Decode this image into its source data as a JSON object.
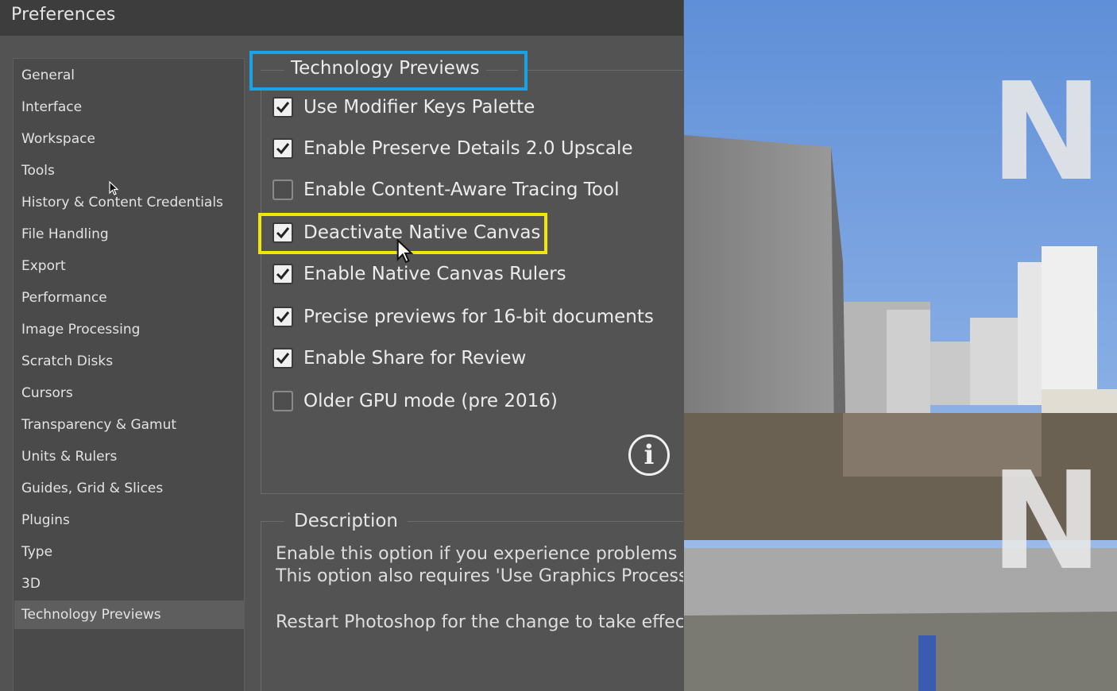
{
  "window": {
    "title": "Preferences"
  },
  "sidebar": {
    "items": [
      {
        "label": "General"
      },
      {
        "label": "Interface"
      },
      {
        "label": "Workspace"
      },
      {
        "label": "Tools"
      },
      {
        "label": "History & Content Credentials"
      },
      {
        "label": "File Handling"
      },
      {
        "label": "Export"
      },
      {
        "label": "Performance"
      },
      {
        "label": "Image Processing"
      },
      {
        "label": "Scratch Disks"
      },
      {
        "label": "Cursors"
      },
      {
        "label": "Transparency & Gamut"
      },
      {
        "label": "Units & Rulers"
      },
      {
        "label": "Guides, Grid & Slices"
      },
      {
        "label": "Plugins"
      },
      {
        "label": "Type"
      },
      {
        "label": "3D"
      },
      {
        "label": "Technology Previews",
        "selected": true
      }
    ]
  },
  "technology_previews": {
    "title": "Technology Previews",
    "options": [
      {
        "label": "Use Modifier Keys Palette",
        "checked": true
      },
      {
        "label": "Enable Preserve Details 2.0 Upscale",
        "checked": true
      },
      {
        "label": "Enable Content-Aware Tracing Tool",
        "checked": false
      },
      {
        "label": "Deactivate Native Canvas",
        "checked": true
      },
      {
        "label": "Enable Native Canvas Rulers",
        "checked": true
      },
      {
        "label": "Precise previews for 16-bit documents",
        "checked": true
      },
      {
        "label": "Enable Share for Review",
        "checked": true
      },
      {
        "label": "Older GPU mode (pre 2016)",
        "checked": false
      }
    ],
    "info_icon": "info-icon"
  },
  "description": {
    "title": "Description",
    "line1": "Enable this option if you experience problems w",
    "line2": "This option also requires 'Use Graphics Process",
    "line3": "Restart Photoshop for the change to take effec"
  },
  "annotations": {
    "blue_box_color": "#17a3e6",
    "yellow_box_color": "#f2e50b"
  },
  "photo": {
    "watermark_letter": "N"
  }
}
